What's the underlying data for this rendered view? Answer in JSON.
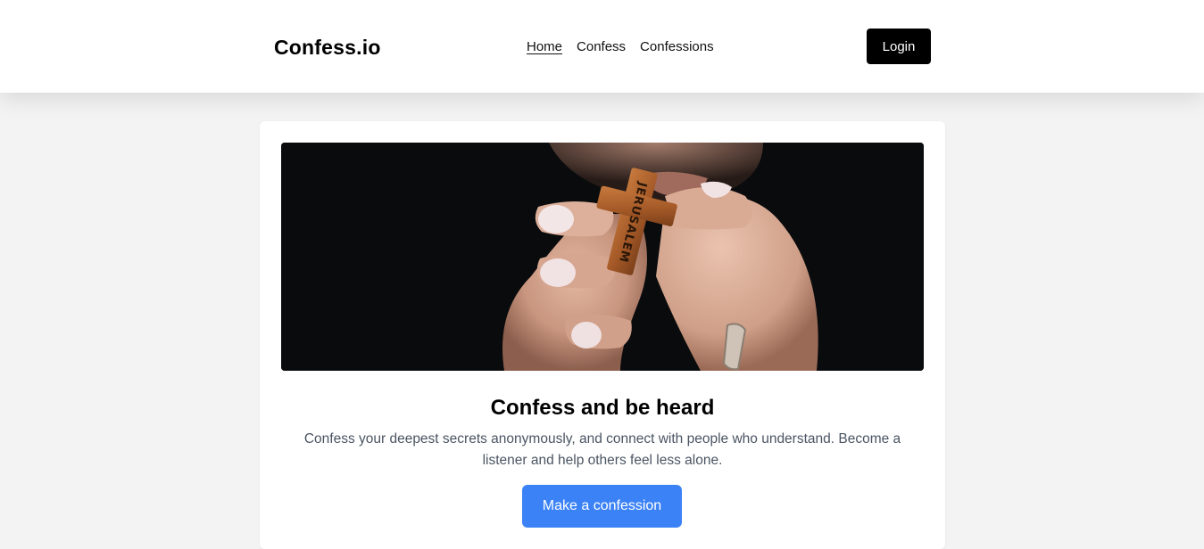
{
  "nav": {
    "brand": "Confess.io",
    "links": [
      {
        "label": "Home",
        "active": true
      },
      {
        "label": "Confess",
        "active": false
      },
      {
        "label": "Confessions",
        "active": false
      }
    ],
    "login_label": "Login"
  },
  "hero": {
    "cross_text": "JERUSALEM"
  },
  "main": {
    "headline": "Confess and be heard",
    "description": "Confess your deepest secrets anonymously, and connect with people who understand. Become a listener and help others feel less alone.",
    "cta_label": "Make a confession"
  },
  "colors": {
    "page_bg": "#f3f3f3",
    "navbar_bg": "#ffffff",
    "login_bg": "#000000",
    "cta_bg": "#3b82f6",
    "text_muted": "#4b5563"
  }
}
